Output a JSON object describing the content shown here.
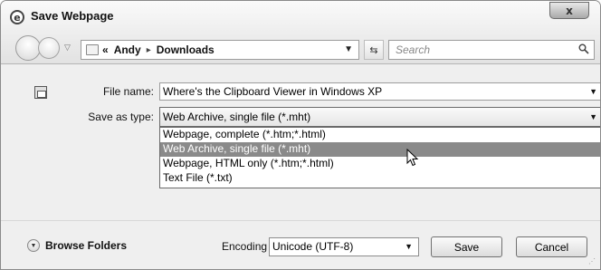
{
  "window": {
    "title": "Save Webpage",
    "close_label": "x"
  },
  "navigation": {
    "address": {
      "prefix": "«",
      "crumbs": [
        "Andy",
        "Downloads"
      ]
    },
    "search_placeholder": "Search"
  },
  "form": {
    "file_name": {
      "label": "File name:",
      "value": "Where's the Clipboard Viewer in Windows XP"
    },
    "save_as_type": {
      "label": "Save as type:",
      "value": "Web Archive, single file (*.mht)",
      "options": [
        "Webpage, complete (*.htm;*.html)",
        "Web Archive, single file (*.mht)",
        "Webpage, HTML only (*.htm;*.html)",
        "Text File (*.txt)"
      ],
      "highlighted_index": 1
    }
  },
  "footer": {
    "browse_folders_label": "Browse Folders",
    "encoding_label": "Encoding",
    "encoding_value": "Unicode (UTF-8)",
    "save_label": "Save",
    "cancel_label": "Cancel"
  },
  "icons": {
    "title": "ie-globe-icon",
    "back": "back-arrow-icon",
    "forward": "forward-arrow-icon",
    "folder": "folder-icon",
    "refresh": "refresh-icon",
    "search": "search-icon",
    "page": "webpage-icon",
    "cursor": "mouse-cursor-icon",
    "browse": "chevron-down-circle-icon"
  },
  "colors": {
    "highlight": "#8a8a8a",
    "window_bg": "#efefef"
  }
}
